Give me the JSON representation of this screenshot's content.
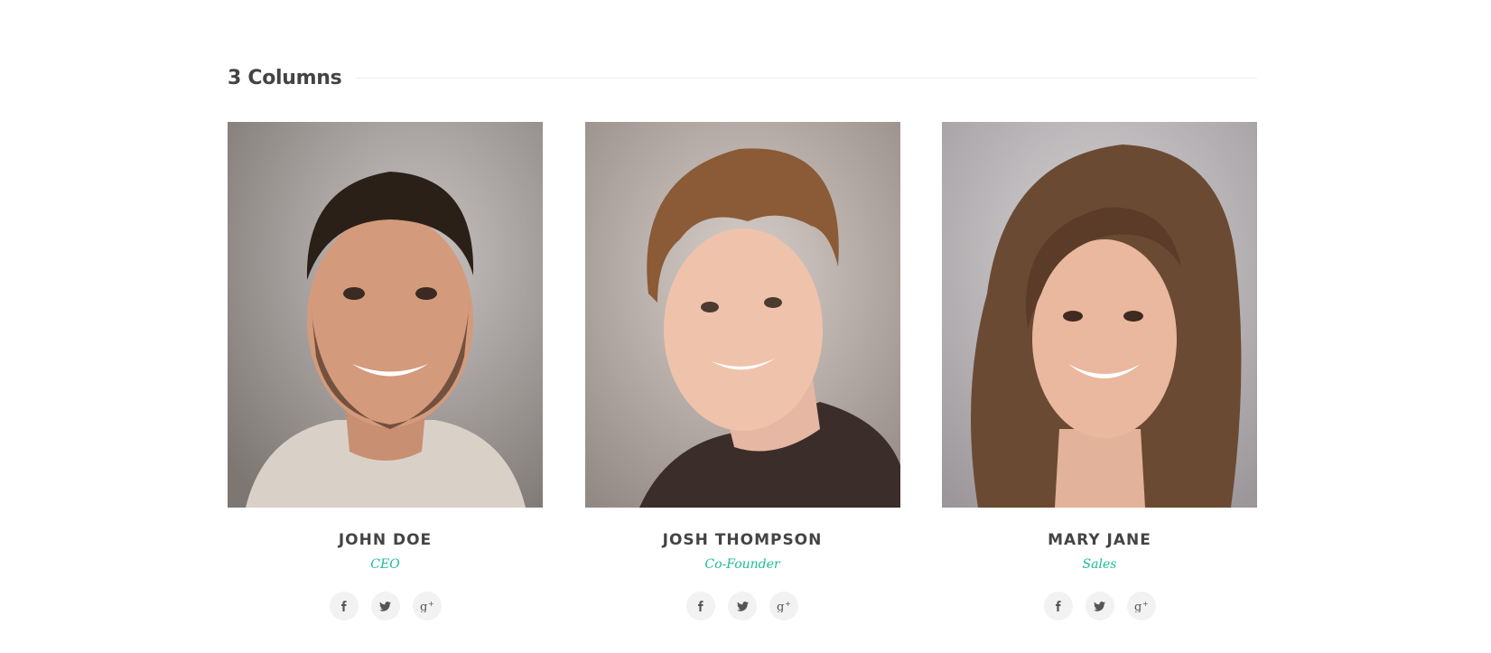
{
  "section": {
    "title": "3 Columns"
  },
  "members": [
    {
      "name": "JOHN DOE",
      "role": "CEO",
      "photo": "portrait-photo-smiling-man-beard"
    },
    {
      "name": "JOSH THOMPSON",
      "role": "Co-Founder",
      "photo": "portrait-photo-young-man-tousled-hair"
    },
    {
      "name": "MARY JANE",
      "role": "Sales",
      "photo": "portrait-photo-smiling-woman-long-hair"
    }
  ],
  "social_icons": [
    "facebook-icon",
    "twitter-icon",
    "google-plus-icon"
  ],
  "colors": {
    "accent": "#1abc9c",
    "heading": "#444444",
    "social_bg": "#f2f2f2"
  }
}
